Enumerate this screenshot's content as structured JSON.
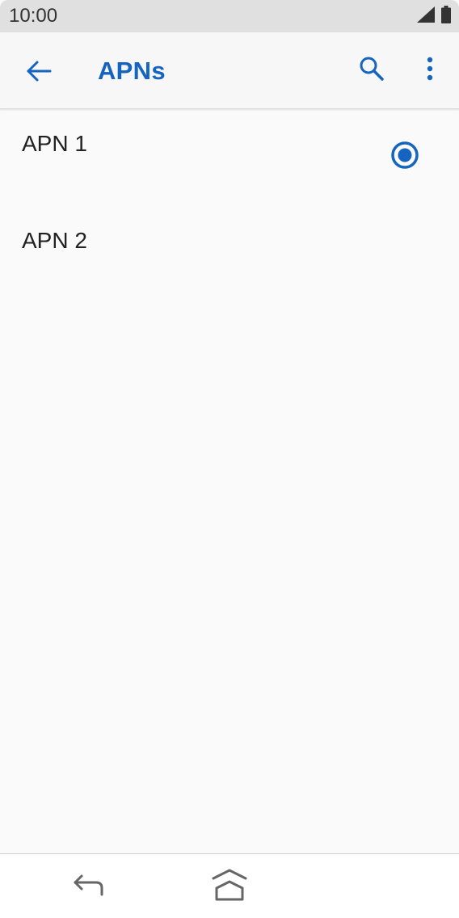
{
  "status_bar": {
    "time": "10:00",
    "signal_icon": "signal-icon",
    "battery_icon": "battery-icon"
  },
  "app_bar": {
    "title": "APNs",
    "back_icon": "arrow-back-icon",
    "search_icon": "search-icon",
    "more_icon": "more-vertical-icon"
  },
  "apn_list": {
    "items": [
      {
        "name": "APN 1",
        "selected": true
      },
      {
        "name": "APN 2",
        "selected": false
      }
    ]
  },
  "nav_bar": {
    "back_icon": "nav-back-icon",
    "home_icon": "home-icon"
  },
  "colors": {
    "accent": "#1565c0",
    "status_bar_bg": "#e0e0e0",
    "background": "#fafafa",
    "text_primary": "#222222"
  }
}
